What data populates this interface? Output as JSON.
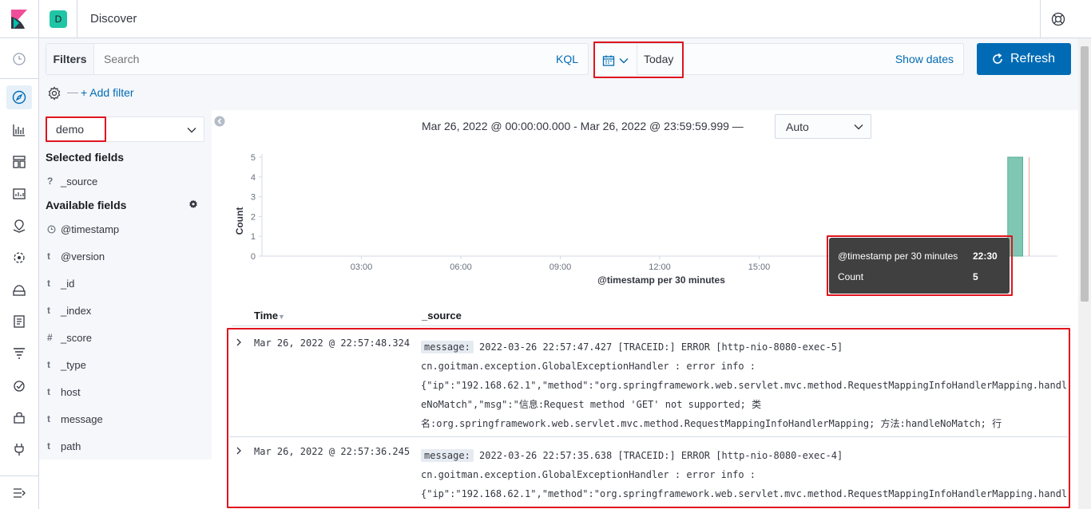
{
  "header": {
    "app_title": "Discover",
    "space_initial": "D"
  },
  "nav": {
    "icons": [
      "clock-icon",
      "compass-icon",
      "visualize-icon",
      "dashboard-icon",
      "canvas-icon",
      "maps-icon",
      "ml-icon",
      "infrastructure-icon",
      "logs-icon",
      "apm-icon",
      "uptime-icon",
      "security-icon",
      "devtools-icon",
      "collapse-nav-icon"
    ]
  },
  "query_bar": {
    "filters_label": "Filters",
    "search_placeholder": "Search",
    "kql_label": "KQL",
    "date_value": "Today",
    "show_dates_label": "Show dates",
    "refresh_label": "Refresh",
    "add_filter_label": "+ Add filter",
    "dash": "—"
  },
  "sidebar": {
    "index_pattern": "demo",
    "selected_fields_title": "Selected fields",
    "available_fields_title": "Available fields",
    "selected_fields": [
      {
        "type": "?",
        "name": "_source"
      }
    ],
    "available_fields": [
      {
        "type": "clock",
        "name": "@timestamp"
      },
      {
        "type": "t",
        "name": "@version"
      },
      {
        "type": "t",
        "name": "_id"
      },
      {
        "type": "t",
        "name": "_index"
      },
      {
        "type": "#",
        "name": "_score"
      },
      {
        "type": "t",
        "name": "_type"
      },
      {
        "type": "t",
        "name": "host"
      },
      {
        "type": "t",
        "name": "message"
      },
      {
        "type": "t",
        "name": "path"
      }
    ]
  },
  "main": {
    "time_range": "Mar 26, 2022 @ 00:00:00.000 - Mar 26, 2022 @ 23:59:59.999 —",
    "interval": "Auto"
  },
  "chart_data": {
    "type": "bar",
    "xlabel": "@timestamp per 30 minutes",
    "ylabel": "Count",
    "x_ticks": [
      "03:00",
      "06:00",
      "09:00",
      "12:00",
      "15:00"
    ],
    "y_ticks": [
      "0",
      "1",
      "2",
      "3",
      "4",
      "5"
    ],
    "ylim": [
      0,
      5
    ],
    "bars": [
      {
        "x": "22:30",
        "count": 5
      }
    ],
    "colors": {
      "bar": "#54b399",
      "now_line": "#e7664c"
    }
  },
  "tooltip": {
    "key1": "@timestamp per 30 minutes",
    "val1": "22:30",
    "key2": "Count",
    "val2": "5"
  },
  "table": {
    "col_time": "Time",
    "col_source": "_source",
    "rows": [
      {
        "time": "Mar 26, 2022 @ 22:57:48.324",
        "msg_key": "message:",
        "lines": [
          "2022-03-26 22:57:47.427 [TRACEID:] ERROR [http-nio-8080-exec-5]",
          "cn.goitman.exception.GlobalExceptionHandler : error info :",
          "{\"ip\":\"192.168.62.1\",\"method\":\"org.springframework.web.servlet.mvc.method.RequestMappingInfoHandlerMapping.handl",
          "eNoMatch\",\"msg\":\"信息:Request method 'GET' not supported; 类",
          "名:org.springframework.web.servlet.mvc.method.RequestMappingInfoHandlerMapping; 方法:handleNoMatch; 行"
        ]
      },
      {
        "time": "Mar 26, 2022 @ 22:57:36.245",
        "msg_key": "message:",
        "lines": [
          "2022-03-26 22:57:35.638 [TRACEID:] ERROR [http-nio-8080-exec-4]",
          "cn.goitman.exception.GlobalExceptionHandler : error info :",
          "{\"ip\":\"192.168.62.1\",\"method\":\"org.springframework.web.servlet.mvc.method.RequestMappingInfoHandlerMapping.handl"
        ]
      }
    ]
  }
}
